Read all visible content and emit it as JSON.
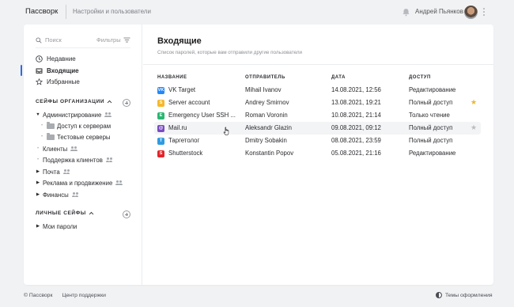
{
  "header": {
    "app_title": "Пассворк",
    "section": "Настройки и пользователи",
    "user_name": "Андрей Пьянков"
  },
  "sidebar": {
    "search_placeholder": "Поиск",
    "filters_label": "Фильтры",
    "nav": [
      {
        "label": "Недавние",
        "icon": "clock-icon"
      },
      {
        "label": "Входящие",
        "icon": "inbox-icon",
        "active": true
      },
      {
        "label": "Избранные",
        "icon": "star-icon"
      }
    ],
    "org_group_title": "СЕЙФЫ ОРГАНИЗАЦИИ",
    "org_items": [
      {
        "label": "Администрирование",
        "expanded": true
      },
      {
        "label": "Доступ к серверам",
        "child": true
      },
      {
        "label": "Тестовые серверы",
        "child": true
      },
      {
        "label": "Клиенты"
      },
      {
        "label": "Поддержка клиентов"
      },
      {
        "label": "Почта"
      },
      {
        "label": "Реклама и продвижение"
      },
      {
        "label": "Финансы"
      }
    ],
    "personal_group_title": "ЛИЧНЫЕ СЕЙФЫ",
    "personal_items": [
      {
        "label": "Мои пароли"
      }
    ]
  },
  "main": {
    "title": "Входящие",
    "subtitle": "Список паролей, которые вам отправили другие пользователи",
    "columns": [
      "НАЗВАНИЕ",
      "ОТПРАВИТЕЛЬ",
      "ДАТА",
      "ДОСТУП"
    ],
    "rows": [
      {
        "name": "VK Target",
        "icon_letter": "VK",
        "icon_color": "#2787f5",
        "sender": "Mihail Ivanov",
        "date": "14.08.2021, 12:56",
        "access": "Редактирование",
        "star": ""
      },
      {
        "name": "Server account",
        "icon_letter": "S",
        "icon_color": "#f5b82e",
        "sender": "Andrey Smirnov",
        "date": "13.08.2021, 19:21",
        "access": "Полный доступ",
        "star": "gold"
      },
      {
        "name": "Emergency User SSH ...",
        "icon_letter": "E",
        "icon_color": "#2bb673",
        "sender": "Roman Voronin",
        "date": "10.08.2021, 21:14",
        "access": "Только чтение",
        "star": ""
      },
      {
        "name": "Mail.ru",
        "icon_letter": "@",
        "icon_color": "#7a4bc2",
        "sender": "Aleksandr Glazin",
        "date": "09.08.2021, 09:12",
        "access": "Полный доступ",
        "star": "grey",
        "hover": true
      },
      {
        "name": "Таргетолог",
        "icon_letter": "T",
        "icon_color": "#2f9be0",
        "sender": "Dmitry Sobakin",
        "date": "08.08.2021, 23:59",
        "access": "Полный доступ",
        "star": ""
      },
      {
        "name": "Shutterstock",
        "icon_letter": "S",
        "icon_color": "#e3252a",
        "sender": "Konstantin Popov",
        "date": "05.08.2021, 21:16",
        "access": "Редактирование",
        "star": ""
      }
    ]
  },
  "footer": {
    "copyright": "© Пассворк",
    "support": "Центр поддержки",
    "theme": "Темы оформления"
  }
}
